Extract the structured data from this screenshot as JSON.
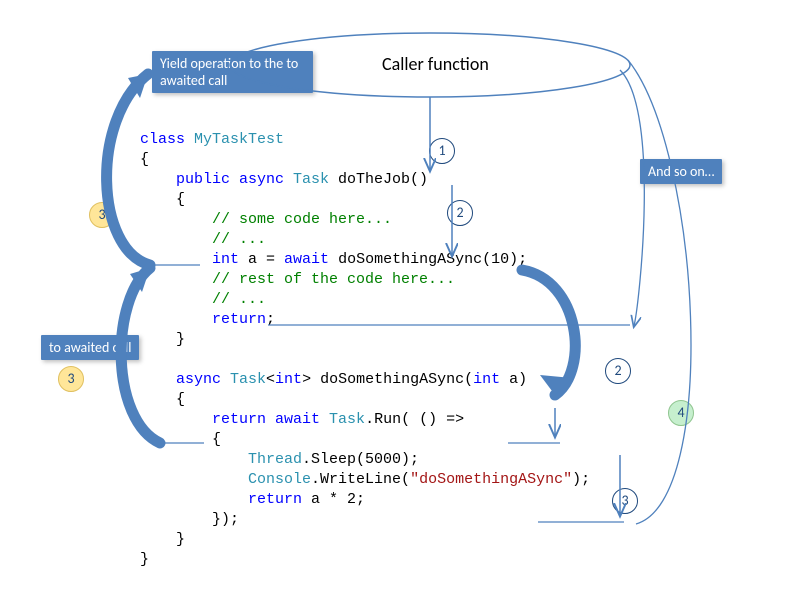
{
  "title": "Caller function",
  "callouts": {
    "yield": "Yield operation to\nthe to awaited call",
    "awaited": "to awaited call",
    "andsoon": "And so on…"
  },
  "steps": {
    "s1": "1",
    "s2a": "2",
    "s2b": "2",
    "s3a": "3",
    "s3b": "3",
    "s3c": "3",
    "s4": "4"
  },
  "code": {
    "l1a": "class",
    "l1b": " MyTaskTest",
    "l2": "{",
    "l3a": "    public",
    "l3b": " async",
    "l3c": " Task",
    "l3d": " doTheJob()",
    "l4": "    {",
    "l5": "        // some code here...",
    "l6": "        // ...",
    "l7a": "        int",
    "l7b": " a = ",
    "l7c": "await",
    "l7d": " doSomethingASync(10);",
    "l8": "        // rest of the code here...",
    "l9": "        // ...",
    "l10a": "        return",
    "l10b": ";",
    "l11": "    }",
    "l13a": "    async",
    "l13b": " Task",
    "l13c": "<",
    "l13d": "int",
    "l13e": "> doSomethingASync(",
    "l13f": "int",
    "l13g": " a)",
    "l14": "    {",
    "l15a": "        return",
    "l15b": " await",
    "l15c": " Task",
    "l15d": ".Run( () =>",
    "l16": "        {",
    "l17a": "            Thread",
    "l17b": ".Sleep(5000);",
    "l18a": "            Console",
    "l18b": ".WriteLine(",
    "l18c": "\"doSomethingASync\"",
    "l18d": ");",
    "l19a": "            return",
    "l19b": " a * 2;",
    "l20": "        });",
    "l21": "    }",
    "l22": "}"
  }
}
